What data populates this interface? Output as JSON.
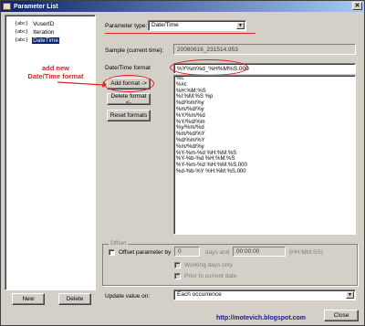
{
  "window": {
    "title": "Parameter List",
    "close_glyph": "✕"
  },
  "tree": {
    "items": [
      {
        "label": "VuserID",
        "selected": false,
        "icon": "{abc}"
      },
      {
        "label": "Iteration",
        "selected": false,
        "icon": "{abc}"
      },
      {
        "label": "DateTime",
        "selected": true,
        "icon": "{abc}"
      }
    ]
  },
  "left_buttons": {
    "new_label": "New",
    "delete_label": "Delete"
  },
  "param_type": {
    "label": "Parameter type:",
    "value": "Date/Time"
  },
  "sample": {
    "label": "Sample (current time):",
    "value": "20080616_231514.953"
  },
  "datetime_format": {
    "label": "Date/Time format",
    "value": "%Y%m%d_%H%M%S.000",
    "formats": [
      "%c",
      "%#c",
      "%H:%M:%S",
      "%I:%M:%S %p",
      "%d/%m/%y",
      "%m/%d/%y",
      "%Y/%m/%d",
      "%Y/%d/%m",
      "%y/%m/%d",
      "%m/%d/%Y",
      "%d/%m/%Y",
      "%m/%d/%y",
      "%Y-%m-%d %H:%M:%S",
      "%Y-%b-%d %H:%M:%S",
      "%Y-%m-%d %H:%M:%S.000",
      "%d-%b-%Y %H:%M:%S.000"
    ]
  },
  "format_buttons": {
    "add_label": "Add format ->",
    "delete_label": "Delete format <-",
    "reset_label": "Reset formats"
  },
  "offset": {
    "group_title": "Offset",
    "offset_label": "Offset parameter by",
    "days_value": "0",
    "days_label": "days and",
    "time_value": "00:00:00",
    "time_hint": "(HH:MM:SS)",
    "working_days_label": "Working days only",
    "prior_label": "Prior to current date"
  },
  "update": {
    "label": "Update value on:",
    "value": "Each occurrence"
  },
  "close_label": "Close",
  "annotation": {
    "line1": "add new",
    "line2": "Date/Time format"
  },
  "watermark": "http://motevich.blogspot.com",
  "colors": {
    "annotation": "#e02020",
    "selection": "#0a246a",
    "titlebar": "#0a246a"
  }
}
